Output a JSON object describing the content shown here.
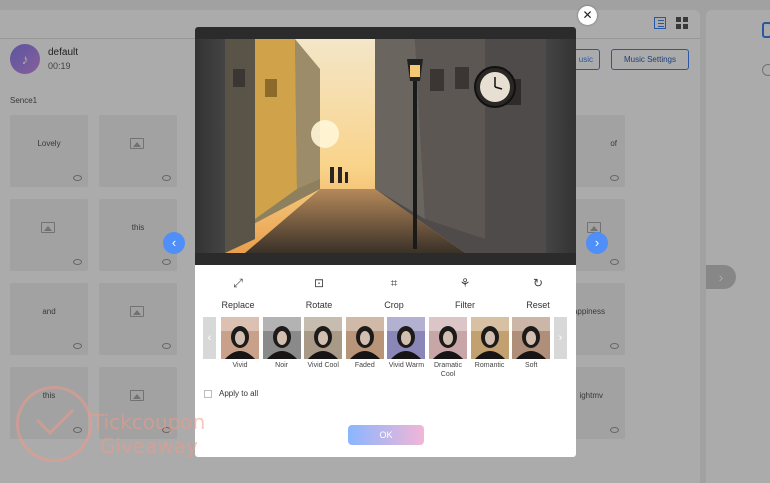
{
  "music": {
    "name": "default",
    "duration": "00:19",
    "music_button_partial": "usic",
    "settings_button": "Music Settings"
  },
  "scene": {
    "label": "Sence1",
    "tiles_left_col": [
      "Lovely",
      "",
      "",
      "this"
    ],
    "tiles_col2": [
      "",
      "this",
      "",
      ""
    ],
    "tiles_right_col": [
      "of",
      "",
      "appiness",
      "ightmv"
    ],
    "row3_left": "and"
  },
  "editor": {
    "tools": [
      {
        "label": "Replace",
        "icon": "replace-icon"
      },
      {
        "label": "Rotate",
        "icon": "rotate-icon"
      },
      {
        "label": "Crop",
        "icon": "crop-icon"
      },
      {
        "label": "Filter",
        "icon": "filter-icon"
      },
      {
        "label": "Reset",
        "icon": "reset-icon"
      }
    ],
    "filters": [
      {
        "label": "Vivid",
        "tint": "#c9a08a"
      },
      {
        "label": "Noir",
        "tint": "#8a8a8a"
      },
      {
        "label": "Vivid Cool",
        "tint": "#a89a86"
      },
      {
        "label": "Faded",
        "tint": "#b89478"
      },
      {
        "label": "Vivid Warm",
        "tint": "#8a87b8"
      },
      {
        "label": "Dramatic Cool",
        "tint": "#c8a6a8"
      },
      {
        "label": "Romantic",
        "tint": "#c2a070"
      },
      {
        "label": "Soft",
        "tint": "#b08f7a"
      }
    ],
    "apply_all_label": "Apply to all",
    "ok_label": "OK"
  },
  "watermark": {
    "line1": "Tickcoupon",
    "line2": "Giveaway"
  },
  "colors": {
    "accent": "#4f8ff7",
    "ok_gradient_start": "#8ab6ff",
    "ok_gradient_end": "#f2b6d6"
  }
}
